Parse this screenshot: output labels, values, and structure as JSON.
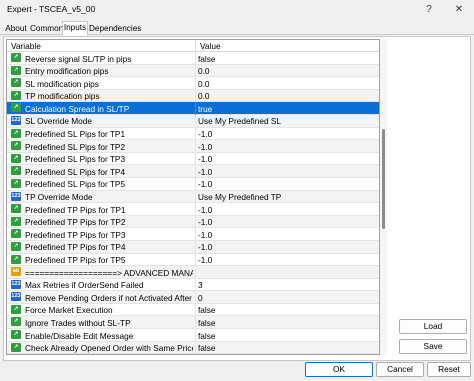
{
  "window": {
    "title": "Expert - TSCEA_v5_00"
  },
  "tabs": [
    "About",
    "Common",
    "Inputs",
    "Dependencies"
  ],
  "table": {
    "headers": [
      "Variable",
      "Value"
    ],
    "rows": [
      {
        "icon": "green",
        "name": "Reverse signal SL/TP in pips",
        "value": "false"
      },
      {
        "icon": "green",
        "name": "Entry modification pips",
        "value": "0.0"
      },
      {
        "icon": "green",
        "name": "SL modification pips",
        "value": "0.0"
      },
      {
        "icon": "green",
        "name": "TP modification pips",
        "value": "0.0"
      },
      {
        "icon": "green",
        "name": "Calculation Spread in SL/TP",
        "value": "true",
        "selected": true
      },
      {
        "icon": "blue",
        "name": "SL Override Mode",
        "value": "Use My Predefined SL"
      },
      {
        "icon": "green",
        "name": "Predefined SL Pips for TP1",
        "value": "-1.0"
      },
      {
        "icon": "green",
        "name": "Predefined SL Pips for TP2",
        "value": "-1.0"
      },
      {
        "icon": "green",
        "name": "Predefined SL Pips for TP3",
        "value": "-1.0"
      },
      {
        "icon": "green",
        "name": "Predefined SL Pips for TP4",
        "value": "-1.0"
      },
      {
        "icon": "green",
        "name": "Predefined SL Pips for TP5",
        "value": "-1.0"
      },
      {
        "icon": "blue",
        "name": "TP Override Mode",
        "value": "Use My Predefined TP"
      },
      {
        "icon": "green",
        "name": "Predefined TP Pips for TP1",
        "value": "-1.0"
      },
      {
        "icon": "green",
        "name": "Predefined TP Pips for TP2",
        "value": "-1.0"
      },
      {
        "icon": "green",
        "name": "Predefined TP Pips for TP3",
        "value": "-1.0"
      },
      {
        "icon": "green",
        "name": "Predefined TP Pips for TP4",
        "value": "-1.0"
      },
      {
        "icon": "green",
        "name": "Predefined TP Pips for TP5",
        "value": "-1.0"
      },
      {
        "icon": "ab",
        "name": "===================> ADVANCED MANAGEMENT",
        "value": ""
      },
      {
        "icon": "blue",
        "name": "Max Retries if OrderSend Failed",
        "value": "3"
      },
      {
        "icon": "blue",
        "name": "Remove Pending Orders if not Activated After X Times...",
        "value": "0"
      },
      {
        "icon": "green",
        "name": "Force Market Execution",
        "value": "false"
      },
      {
        "icon": "green",
        "name": "Ignore Trades without SL-TP",
        "value": "false"
      },
      {
        "icon": "green",
        "name": "Enable/Disable Edit Message",
        "value": "false"
      },
      {
        "icon": "green",
        "name": "Check Already Opened Order with Same Price",
        "value": "false"
      }
    ]
  },
  "buttons": {
    "load": "Load",
    "save": "Save",
    "ok": "OK",
    "cancel": "Cancel",
    "reset": "Reset"
  },
  "colors": {
    "selection": "#0a6fd6",
    "green_icon": "#2e9e3e",
    "blue_icon": "#2466c8",
    "ab_icon": "#e1a400"
  }
}
